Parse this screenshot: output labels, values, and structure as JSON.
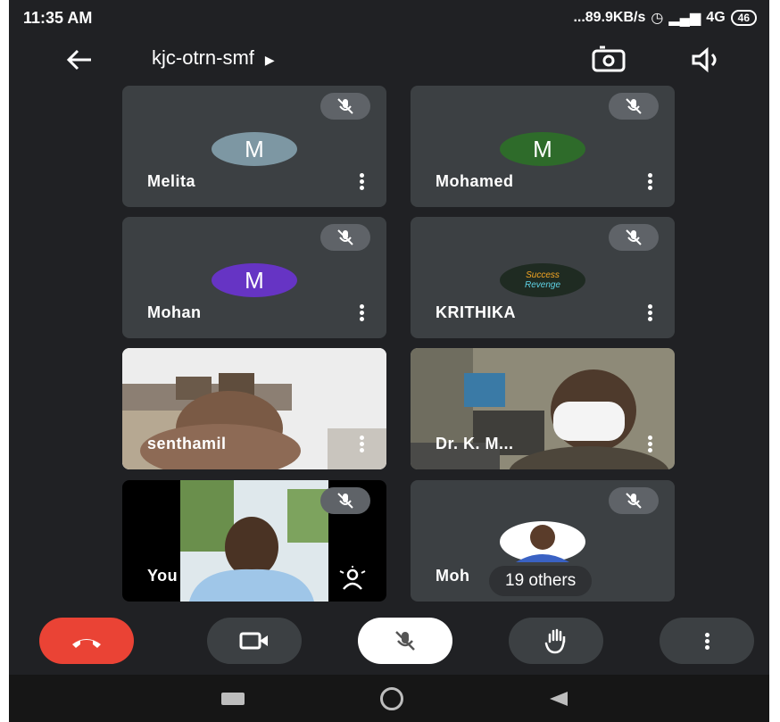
{
  "status_bar": {
    "time": "11:35 AM",
    "right_text": "...89.9KB/s",
    "network": "4G",
    "battery": "46"
  },
  "header": {
    "meeting_code": "kjc-otrn-smf"
  },
  "participants": [
    {
      "name": "Melita",
      "initial": "M",
      "avatar_color": "#7d97a3"
    },
    {
      "name": "Mohamed",
      "initial": "M",
      "avatar_color": "#2e6b2a"
    },
    {
      "name": "Mohan",
      "initial": "M",
      "avatar_color": "#6634c4"
    },
    {
      "name": "KRITHIKA",
      "avatar_text_1": "Success",
      "avatar_text_2": "Revenge"
    },
    {
      "name": "senthamil"
    },
    {
      "name": "Dr. K. M..."
    },
    {
      "name": "You"
    },
    {
      "name": "Moh",
      "others": "19 others"
    }
  ],
  "colors": {
    "background": "#202124",
    "tile": "#3c4043",
    "end_call": "#ea4335",
    "mic_button": "#ffffff"
  },
  "icons": [
    "back-arrow-icon",
    "switch-camera-icon",
    "speaker-icon",
    "mic-off-icon",
    "more-vert-icon",
    "end-call-icon",
    "camera-icon",
    "raise-hand-icon"
  ]
}
